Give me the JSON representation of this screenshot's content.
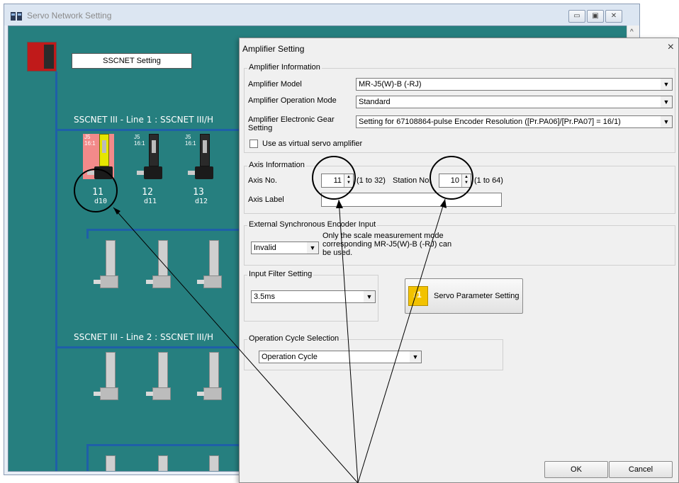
{
  "window": {
    "title": "Servo Network Setting",
    "buttons": {
      "minimize": "▭",
      "restore": "▣",
      "close": "✕"
    },
    "scroll_up": "^"
  },
  "network": {
    "sscnet_button": "SSCNET Setting",
    "line1_label": "SSCNET III - Line 1 : SSCNET III/H",
    "line2_label": "SSCNET III - Line 2 : SSCNET III/H",
    "amplifiers": [
      {
        "tag": "J5\n16:1",
        "axis": "11",
        "station": "d10",
        "selected": true
      },
      {
        "tag": "J5\n16:1",
        "axis": "12",
        "station": "d11",
        "selected": false
      },
      {
        "tag": "J5\n16:1",
        "axis": "13",
        "station": "d12",
        "selected": false
      }
    ],
    "colors": {
      "canvas": "#267f7f",
      "line": "#1f5fa8"
    }
  },
  "dialog": {
    "title": "Amplifier Setting",
    "close": "×",
    "amp_info": {
      "group": "Amplifier Information",
      "model_label": "Amplifier Model",
      "model_value": "MR-J5(W)-B (-RJ)",
      "mode_label": "Amplifier Operation Mode",
      "mode_value": "Standard",
      "gear_label_1": "Amplifier Electronic Gear",
      "gear_label_2": "Setting",
      "gear_value": "Setting for 67108864-pulse Encoder Resolution ([Pr.PA06]/[Pr.PA07] = 16/1)",
      "virtual_label": "Use as virtual servo amplifier"
    },
    "axis_info": {
      "group": "Axis Information",
      "axis_no_label": "Axis No.",
      "axis_no_value": "11",
      "axis_range": "(1 to 32)",
      "station_label": "Station No.",
      "station_value": "10",
      "station_range": "(1 to 64)",
      "axis_label_label": "Axis Label"
    },
    "ext_sync": {
      "group": "External Synchronous Encoder Input",
      "value": "Invalid",
      "note": "Only the scale measurement mode corresponding MR-J5(W)-B (-RJ) can be used."
    },
    "input_filter": {
      "group": "Input Filter Setting",
      "value": "3.5ms"
    },
    "servo_param_button": "Servo Parameter Setting",
    "op_cycle": {
      "group": "Operation Cycle Selection",
      "value": "Operation Cycle"
    },
    "ok": "OK",
    "cancel": "Cancel"
  }
}
